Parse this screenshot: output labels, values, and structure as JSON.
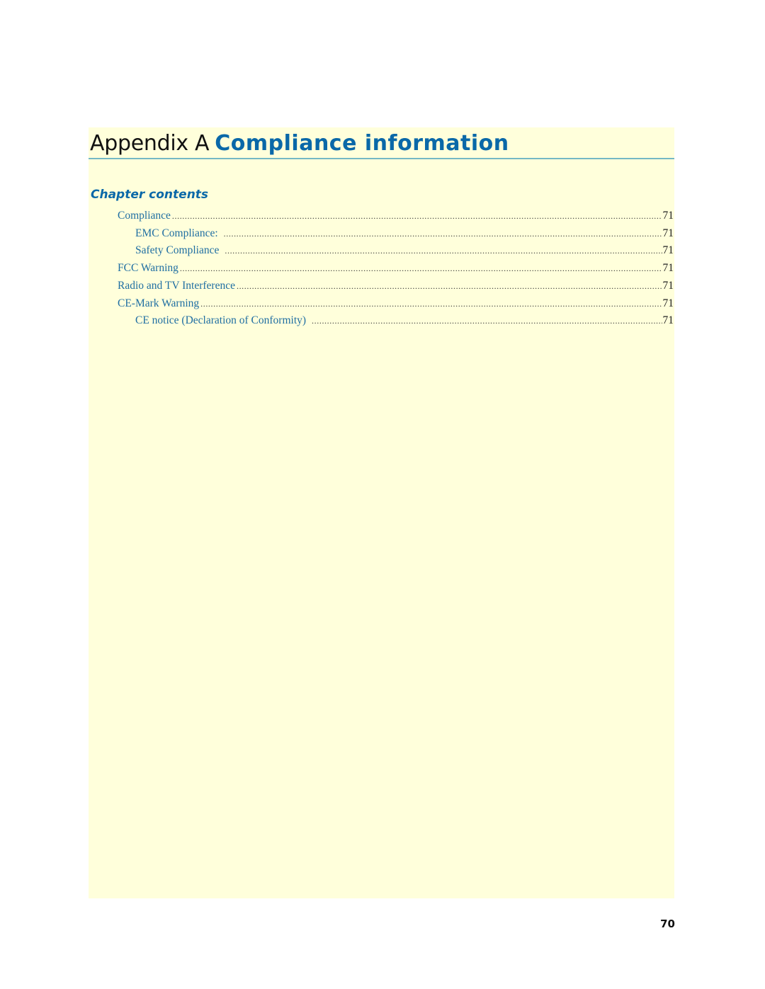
{
  "header": {
    "prefix": "Appendix A",
    "title": "Compliance information"
  },
  "chapter_contents": {
    "heading": "Chapter contents",
    "entries": [
      {
        "label": "Compliance",
        "page": "71",
        "level": 1
      },
      {
        "label": "EMC Compliance:",
        "page": "71",
        "level": 2
      },
      {
        "label": "Safety Compliance",
        "page": "71",
        "level": 2
      },
      {
        "label": "FCC Warning",
        "page": "71",
        "level": 1
      },
      {
        "label": "Radio and TV Interference",
        "page": "71",
        "level": 1
      },
      {
        "label": "CE-Mark Warning",
        "page": "71",
        "level": 1
      },
      {
        "label": "CE notice (Declaration of Conformity)",
        "page": "71",
        "level": 2
      }
    ]
  },
  "footer": {
    "page_number": "70"
  },
  "colors": {
    "panel_background": "#ffffdb",
    "title_blue": "#0a68a8",
    "link_blue": "#1f6ea2",
    "rule": "#74b8c4"
  }
}
